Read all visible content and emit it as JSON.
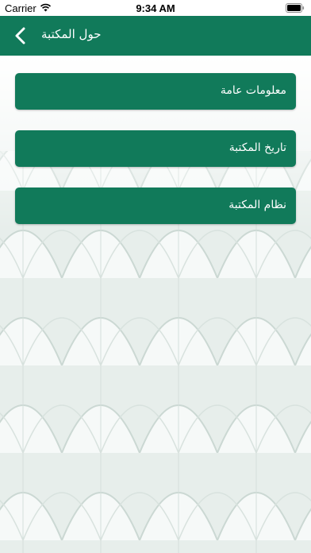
{
  "status_bar": {
    "carrier": "Carrier",
    "time": "9:34 AM"
  },
  "nav": {
    "title": "حول المكتبة",
    "back_icon": "chevron-left-icon"
  },
  "menu": [
    {
      "label": "معلومات عامة"
    },
    {
      "label": "تاريخ المكتبة"
    },
    {
      "label": "نظام المكتبة"
    }
  ],
  "colors": {
    "primary": "#117a5a",
    "background": "#eef3f1"
  }
}
